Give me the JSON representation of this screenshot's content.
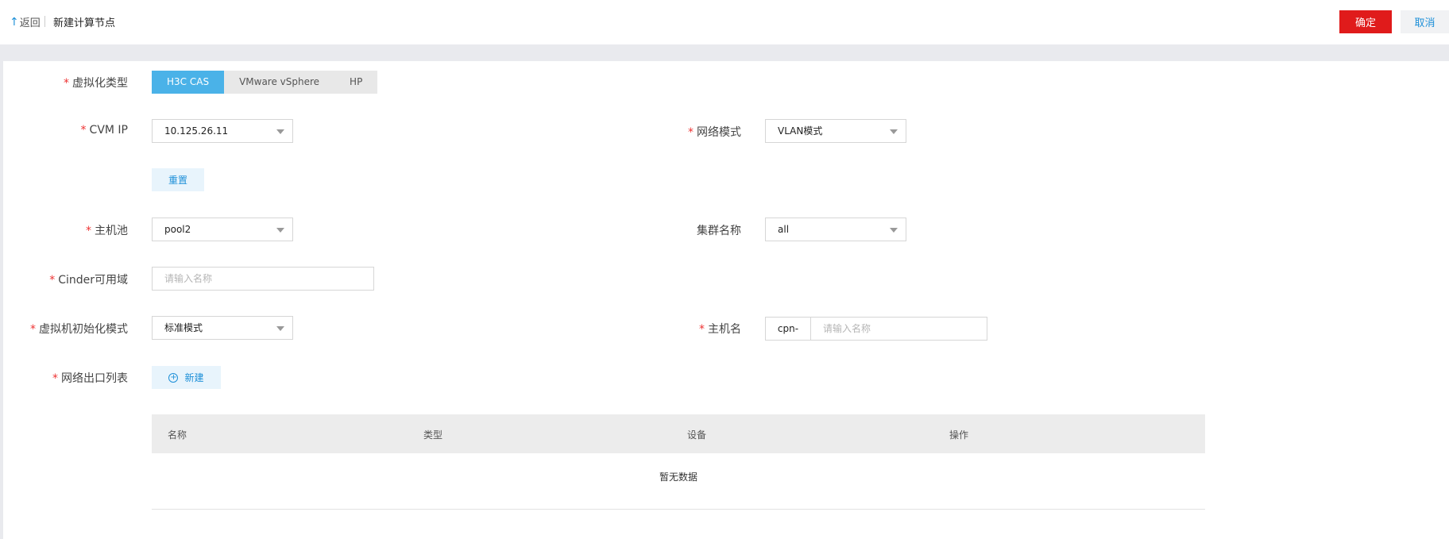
{
  "header": {
    "back_label": "返回",
    "title": "新建计算节点",
    "confirm_label": "确定",
    "cancel_label": "取消"
  },
  "form": {
    "virt_type": {
      "label": "虚拟化类型",
      "options": [
        "H3C CAS",
        "VMware vSphere",
        "HP"
      ],
      "selected": "H3C CAS"
    },
    "cvm_ip": {
      "label": "CVM IP",
      "value": "10.125.26.11"
    },
    "network_mode": {
      "label": "网络模式",
      "value": "VLAN模式"
    },
    "reset_label": "重置",
    "host_pool": {
      "label": "主机池",
      "value": "pool2"
    },
    "cluster_name": {
      "label": "集群名称",
      "value": "all"
    },
    "cinder_zone": {
      "label": "Cinder可用域",
      "placeholder": "请输入名称"
    },
    "vm_init_mode": {
      "label": "虚拟机初始化模式",
      "value": "标准模式"
    },
    "host_name": {
      "label": "主机名",
      "prefix": "cpn-",
      "placeholder": "请输入名称"
    },
    "network_exit_list": {
      "label": "网络出口列表",
      "new_label": "新建"
    }
  },
  "table": {
    "columns": [
      "名称",
      "类型",
      "设备",
      "操作"
    ],
    "empty_text": "暂无数据"
  },
  "colors": {
    "accent": "#1e90d8",
    "danger": "#e01b1b",
    "segment_active": "#4ab2e8"
  }
}
